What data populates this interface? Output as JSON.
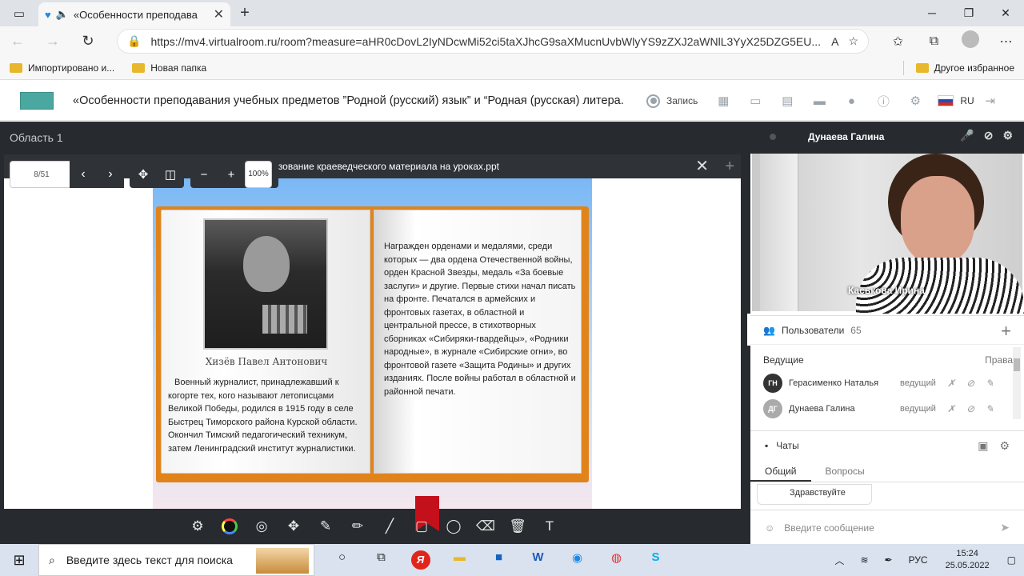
{
  "browser": {
    "tab_title": "«Особенности преподава",
    "url": "https://mv4.virtualroom.ru/room?measure=aHR0cDovL2IyNDcwMi52ci5taXJhcG9saXMucnUvbWlyYS9zZXJ2aWNlL3YyX25DZG5EU..."
  },
  "bookmarks": {
    "items": [
      "Импортировано и...",
      "Новая папка"
    ],
    "other": "Другое избранное"
  },
  "header": {
    "title": "«Особенности преподавания учебных предметов ”Родной (русский) язык” и “Родная (русская) литера...",
    "record": "Запись",
    "lang": "RU"
  },
  "area": {
    "title": "Область 1"
  },
  "presentation": {
    "file": "Использование краеведческого материала на уроках.ppt",
    "page": "8/51",
    "zoom": "100%"
  },
  "slide": {
    "name": "Хизёв Павел Антонович",
    "left_text": "Военный журналист, принадлежавший к когорте тех, кого называют летописцами Великой Победы, родился в 1915 году в селе Быстрец Тиморского района Курской области. Окончил Тимский педагогический техникум, затем Ленинградский институт журналистики.",
    "right_text": "Награжден орденами и медалями, среди которых — два ордена Отечественной войны, орден Красной Звезды, медаль «За боевые заслуги» и другие. Первые стихи начал писать на фронте. Печатался в армейских и фронтовых газетах, в областной и центральной прессе, в стихотворных сборниках «Сибиряки-гвардейцы», «Родники народные», в журнале «Сибирские огни», во фронтовой газете «Защита Родины» и других изданиях. После войны работал в областной и районной печати."
  },
  "speaker": {
    "name": "Дунаева Галина",
    "video_label": "Каськова Ирина"
  },
  "users": {
    "label": "Пользователи",
    "count": "65",
    "leaders_label": "Ведущие",
    "rights_label": "Права",
    "list": [
      {
        "initials": "ГН",
        "name": "Герасименко Наталья",
        "role": "ведущий"
      },
      {
        "initials": "ДГ",
        "name": "Дунаева Галина",
        "role": "ведущий"
      }
    ]
  },
  "chats": {
    "label": "Чаты",
    "tabs": [
      "Общий",
      "Вопросы"
    ],
    "last_message": "Здравствуйте",
    "input_placeholder": "Введите сообщение"
  },
  "taskbar": {
    "search_placeholder": "Введите здесь текст для поиска",
    "lang": "РУС",
    "time": "15:24",
    "date": "25.05.2022"
  }
}
